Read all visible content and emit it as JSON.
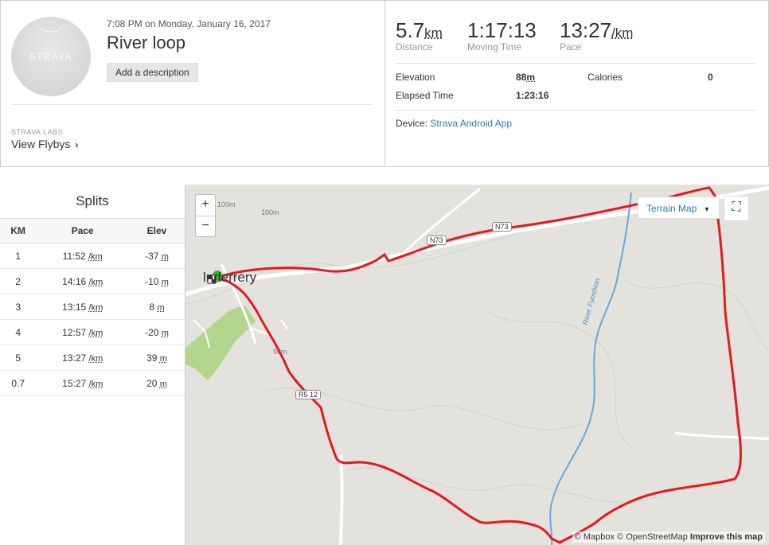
{
  "activity": {
    "date": "7:08 PM on Monday, January 16, 2017",
    "title": "River loop",
    "add_description": "Add a description",
    "avatar_logo": "STRAVA"
  },
  "labs": {
    "label": "STRAVA LABS",
    "flybys": "View Flybys",
    "chevron": "›"
  },
  "stats": {
    "distance": {
      "value": "5.7",
      "unit": "km",
      "label": "Distance"
    },
    "moving_time": {
      "value": "1:17:13",
      "label": "Moving Time"
    },
    "pace": {
      "value": "13:27",
      "unit": "/km",
      "label": "Pace"
    },
    "elevation": {
      "label": "Elevation",
      "value": "88",
      "unit": "m"
    },
    "calories": {
      "label": "Calories",
      "value": "0"
    },
    "elapsed": {
      "label": "Elapsed Time",
      "value": "1:23:16"
    },
    "device_label": "Device:",
    "device_value": "Strava Android App"
  },
  "splits": {
    "title": "Splits",
    "headers": [
      "KM",
      "Pace",
      "Elev"
    ],
    "pace_unit": "/km",
    "elev_unit": "m",
    "rows": [
      {
        "km": "1",
        "pace": "11:52",
        "elev": "-37"
      },
      {
        "km": "2",
        "pace": "14:16",
        "elev": "-10"
      },
      {
        "km": "3",
        "pace": "13:15",
        "elev": "8"
      },
      {
        "km": "4",
        "pace": "12:57",
        "elev": "-20"
      },
      {
        "km": "5",
        "pace": "13:27",
        "elev": "39"
      },
      {
        "km": "0.7",
        "pace": "15:27",
        "elev": "20"
      }
    ]
  },
  "map": {
    "zoom_in": "+",
    "zoom_out": "−",
    "terrain_label": "Terrain Map",
    "caret": "▾",
    "fullscreen_icon": "⛶",
    "attribution_mapbox": "© Mapbox",
    "attribution_osm": "© OpenStreetMap",
    "improve": "Improve this map",
    "town": "Inagh / Derrery",
    "town_visible": "lnderrery",
    "road_n73": "N73",
    "road_r512": "R512",
    "road_r512_visible": "R5 12",
    "contour_100": "100m",
    "contour_90": "90m",
    "river": "River Funshion",
    "route_color": "#e8181f",
    "river_color": "#6aa8dc"
  }
}
